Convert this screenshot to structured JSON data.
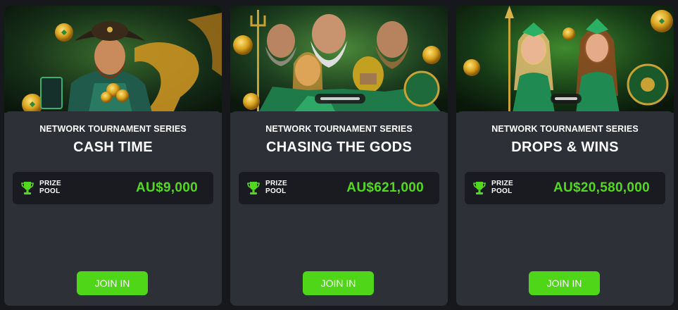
{
  "colors": {
    "page_bg": "#17181c",
    "card_bg": "#2e3038",
    "prize_box_bg": "#1a1b20",
    "accent_green": "#54d81f",
    "button_green": "#4fd619"
  },
  "cards": [
    {
      "series": "NETWORK TOURNAMENT SERIES",
      "title": "CASH TIME",
      "prize_label_line1": "PRIZE",
      "prize_label_line2": "POOL",
      "prize_amount": "AU$9,000",
      "join_label": "JOIN IN",
      "banner_icon": "pirate-with-coins-image",
      "banner_theme": "#1c3a22"
    },
    {
      "series": "NETWORK TOURNAMENT SERIES",
      "title": "CHASING THE GODS",
      "prize_label_line1": "PRIZE",
      "prize_label_line2": "POOL",
      "prize_amount": "AU$621,000",
      "join_label": "JOIN IN",
      "banner_icon": "greek-gods-image",
      "banner_theme": "#1f3d2a"
    },
    {
      "series": "NETWORK TOURNAMENT SERIES",
      "title": "DROPS & WINS",
      "prize_label_line1": "PRIZE",
      "prize_label_line2": "POOL",
      "prize_amount": "AU$20,580,000",
      "join_label": "JOIN IN",
      "banner_icon": "warrior-women-image",
      "banner_theme": "#173a1e"
    }
  ],
  "icons": {
    "trophy": "trophy-icon"
  }
}
